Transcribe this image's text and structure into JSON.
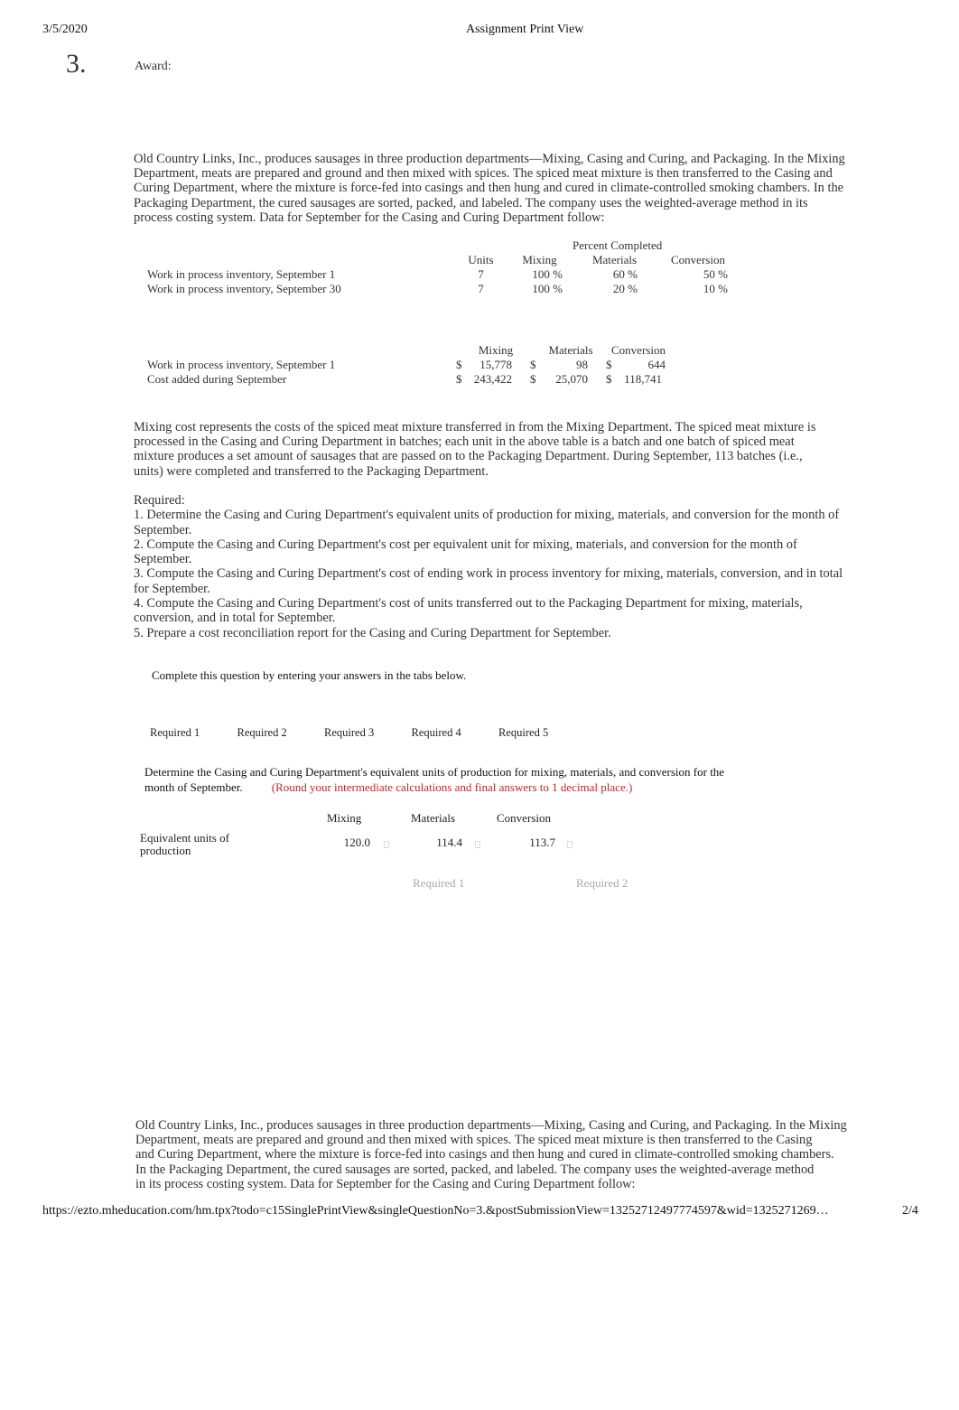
{
  "header": {
    "date": "3/5/2020",
    "title": "Assignment Print View"
  },
  "question": {
    "number": "3.",
    "award_label": "Award:"
  },
  "intro_paragraph_lines": [
    "Old Country Links, Inc., produces sausages in three production departments—Mixing, Casing and Curing, and Packaging. In the Mixing",
    "Department, meats are prepared and ground and then mixed with spices. The spiced meat mixture is then transferred to the Casing and",
    "Curing Department, where the mixture is force-fed into casings and then hung and cured in climate-controlled smoking chambers. In the",
    "Packaging Department, the cured sausages are sorted, packed, and labeled. The company uses the weighted-average method in its",
    "process costing system. Data for September for the Casing and Curing Department follow:"
  ],
  "percent_table": {
    "group_header": "Percent Completed",
    "columns": [
      "Units",
      "Mixing",
      "Materials",
      "Conversion"
    ],
    "rows": [
      {
        "label": "Work in process inventory, September 1",
        "units": "7",
        "mixing": "100 %",
        "materials": "60 %",
        "conversion": "50 %"
      },
      {
        "label": "Work in process inventory, September 30",
        "units": "7",
        "mixing": "100 %",
        "materials": "20 %",
        "conversion": "10 %"
      }
    ]
  },
  "cost_table": {
    "columns": [
      "Mixing",
      "Materials",
      "Conversion"
    ],
    "currency": "$",
    "rows": [
      {
        "label": "Work in process inventory, September 1",
        "mixing": "15,778",
        "materials": "98",
        "conversion": "644"
      },
      {
        "label": "Cost added during September",
        "mixing": "243,422",
        "materials": "25,070",
        "conversion": "118,741"
      }
    ]
  },
  "mixing_paragraph_lines": [
    "Mixing cost represents the costs of the spiced meat mixture transferred in from the Mixing Department. The spiced meat mixture is",
    "processed in the Casing and Curing Department in batches; each unit in the above table is a batch and one batch of spiced meat",
    "mixture produces a set amount of sausages that are passed on to the Packaging Department. During September, 113 batches (i.e.,",
    "units) were completed and transferred to the Packaging Department."
  ],
  "required": {
    "heading": "Required:",
    "lines": [
      "1. Determine the Casing and Curing Department's equivalent units of production for mixing, materials, and conversion for the month of",
      "September.",
      "2. Compute the Casing and Curing Department's cost per equivalent unit for mixing, materials, and conversion for the month of",
      "September.",
      "3. Compute the Casing and Curing Department's cost of ending work in process inventory for mixing, materials, conversion, and in total",
      "for September.",
      "4. Compute the Casing and Curing Department's cost of units transferred out to the Packaging Department for mixing, materials,",
      "conversion, and in total for September.",
      "5. Prepare a cost reconciliation report for the Casing and Curing Department for September."
    ]
  },
  "instructions": "Complete this question by entering your answers in the tabs below.",
  "tabs": [
    {
      "label": "Required 1"
    },
    {
      "label": "Required 2"
    },
    {
      "label": "Required 3"
    },
    {
      "label": "Required 4"
    },
    {
      "label": "Required 5"
    }
  ],
  "task": {
    "line1": "Determine the Casing and Curing Department's equivalent units of production for mixing, materials, and conversion for the",
    "line2": "month of September.",
    "note": "(Round your intermediate calculations and final answers to 1 decimal place.)",
    "note_color": "#c0262a"
  },
  "answer_table": {
    "columns": [
      "Mixing",
      "Materials",
      "Conversion"
    ],
    "row_label_line1": "Equivalent units of",
    "row_label_line2": "production",
    "values": {
      "mixing": "120.0",
      "materials": "114.4",
      "conversion": "113.7"
    }
  },
  "nav": {
    "prev": "Required 1",
    "next": "Required 2"
  },
  "repeat_paragraph_lines": [
    "Old Country Links, Inc., produces sausages in three production departments—Mixing, Casing and Curing, and Packaging. In the Mixing",
    "Department, meats are prepared and ground and then mixed with spices. The spiced meat mixture is then transferred to the Casing",
    "and Curing Department, where the mixture is force-fed into casings and then hung and cured in climate-controlled smoking chambers.",
    "In the Packaging Department, the cured sausages are sorted, packed, and labeled. The company uses the weighted-average method",
    "in its process costing system. Data for September for the Casing and Curing Department follow:"
  ],
  "footer": {
    "url": "https://ezto.mheducation.com/hm.tpx?todo=c15SinglePrintView&singleQuestionNo=3.&postSubmissionView=13252712497774597&wid=1325271269…",
    "page": "2/4"
  }
}
